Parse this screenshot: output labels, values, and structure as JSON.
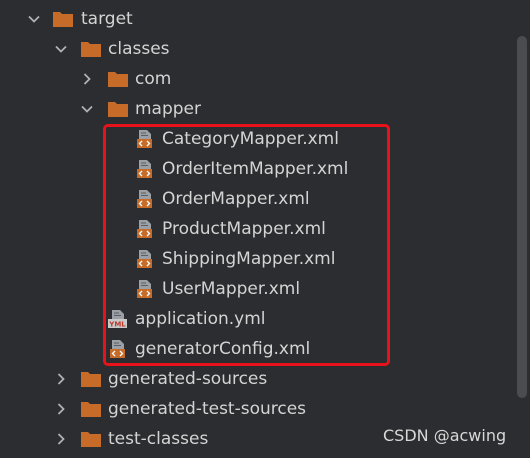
{
  "tree": {
    "target": "target",
    "classes": "classes",
    "com": "com",
    "mapper": "mapper",
    "mapper_files": [
      "CategoryMapper.xml",
      "OrderItemMapper.xml",
      "OrderMapper.xml",
      "ProductMapper.xml",
      "ShippingMapper.xml",
      "UserMapper.xml"
    ],
    "application_yml": "application.yml",
    "generator_config": "generatorConfig.xml",
    "generated_sources": "generated-sources",
    "generated_test_sources": "generated-test-sources",
    "test_classes": "test-classes"
  },
  "icons": {
    "folder": "folder-icon",
    "xml_file": "xml-file-icon",
    "yml_file": "yml-file-icon",
    "expanded": "chevron-down-icon",
    "collapsed": "chevron-right-icon"
  },
  "colors": {
    "background": "#2b2d30",
    "folder": "#c76b29",
    "text": "#d4d4d4",
    "highlight_border": "#e8121a",
    "chevron": "#aeb1b6"
  },
  "watermark": "CSDN @acwing"
}
